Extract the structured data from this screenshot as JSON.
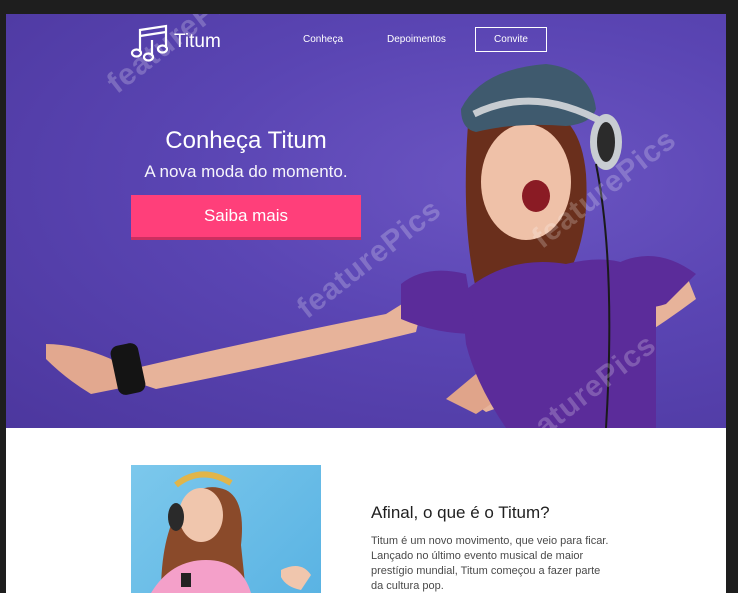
{
  "nav": {
    "logo_text": "Titum",
    "logo_icon": "music-notes-icon",
    "links": [
      "Conheça",
      "Depoimentos"
    ],
    "invite_label": "Convite"
  },
  "hero": {
    "title": "Conheça Titum",
    "subtitle": "A nova moda do momento.",
    "cta_label": "Saiba mais",
    "watermark_text": "featurePics"
  },
  "about": {
    "title": "Afinal, o que é o Titum?",
    "body": "Titum é um novo movimento, que veio para ficar. Lançado no último evento musical de maior prestígio mundial, Titum começou a fazer parte da cultura pop."
  },
  "colors": {
    "hero_purple": "#5a45b3",
    "cta_pink": "#ff3f7a",
    "page_background": "#1e1e1e"
  }
}
